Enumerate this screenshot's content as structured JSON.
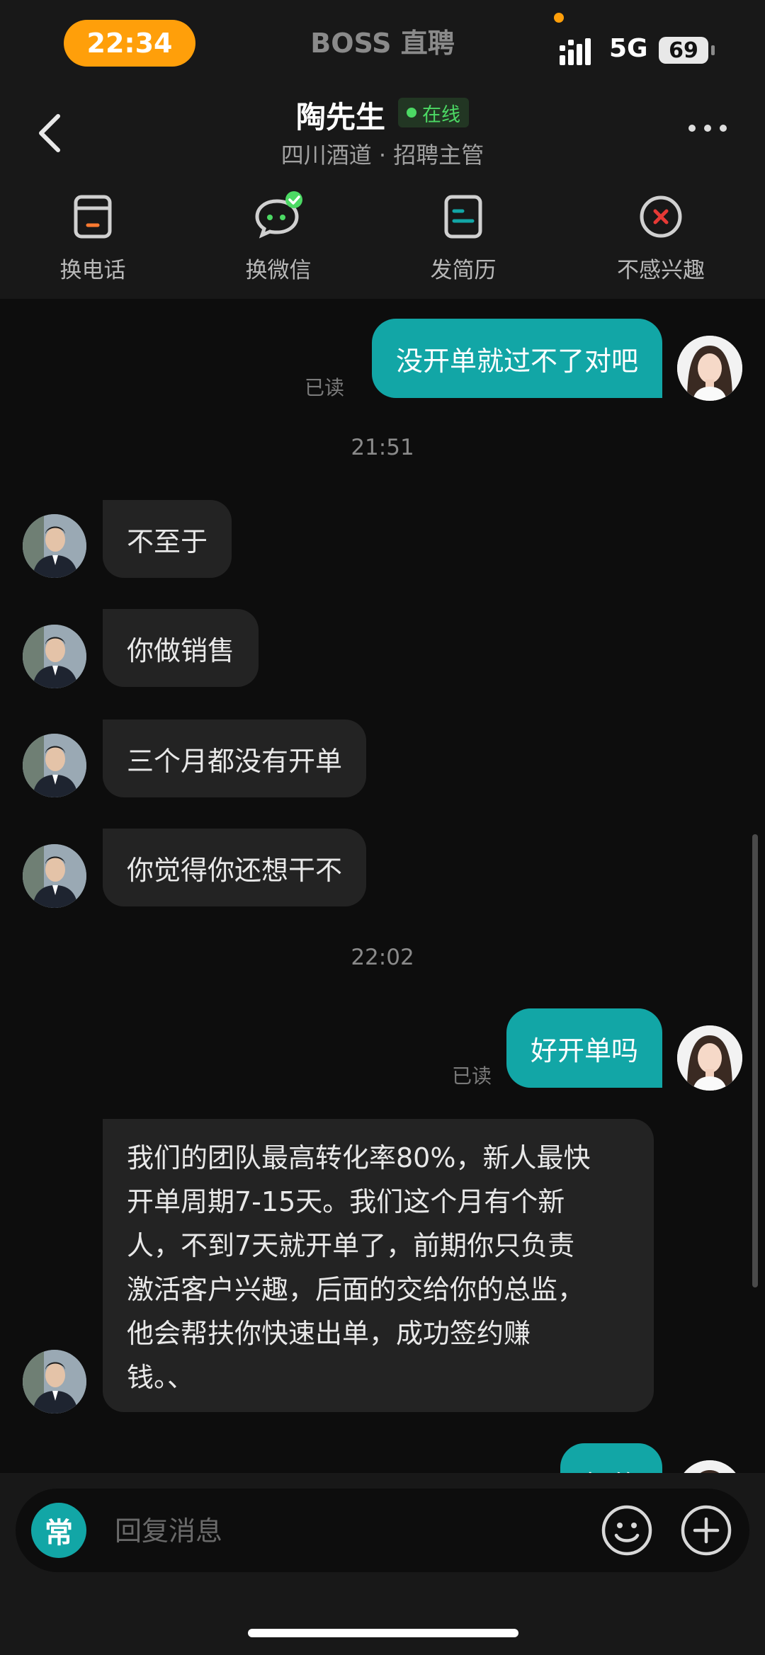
{
  "status_bar": {
    "time": "22:34",
    "app_name": "BOSS 直聘",
    "network": "5G",
    "battery": "69"
  },
  "header": {
    "contact_name": "陶先生",
    "online_badge": "在线",
    "subtitle": "四川酒道 · 招聘主管"
  },
  "actions": [
    {
      "label": "换电话",
      "icon": "phone-swap-icon"
    },
    {
      "label": "换微信",
      "icon": "wechat-swap-icon"
    },
    {
      "label": "发简历",
      "icon": "resume-icon"
    },
    {
      "label": "不感兴趣",
      "icon": "not-interested-icon"
    }
  ],
  "messages": [
    {
      "from": "me",
      "text": "没开单就过不了对吧",
      "status": "已读"
    },
    {
      "type": "time",
      "text": "21:51"
    },
    {
      "from": "them",
      "text": "不至于"
    },
    {
      "from": "them",
      "text": "你做销售"
    },
    {
      "from": "them",
      "text": "三个月都没有开单"
    },
    {
      "from": "them",
      "text": "你觉得你还想干不"
    },
    {
      "type": "time",
      "text": "22:02"
    },
    {
      "from": "me",
      "text": "好开单吗",
      "status": "已读"
    },
    {
      "from": "them",
      "lines": [
        "我们的团队最高转化率80%，新人最快",
        "开单周期7-15天。我们这个月有个新",
        "人，不到7天就开单了，前期你只负责",
        "激活客户兴趣，后面的交给你的总监，",
        "他会帮扶你快速出单，成功签约赚",
        "钱。、"
      ]
    },
    {
      "from": "me",
      "text": "好的"
    }
  ],
  "composer": {
    "quick_label": "常",
    "placeholder": "回复消息"
  },
  "colors": {
    "accent": "#12a6a6",
    "online": "#4cd964",
    "time_pill": "#ff9f0a",
    "danger": "#e53935"
  }
}
